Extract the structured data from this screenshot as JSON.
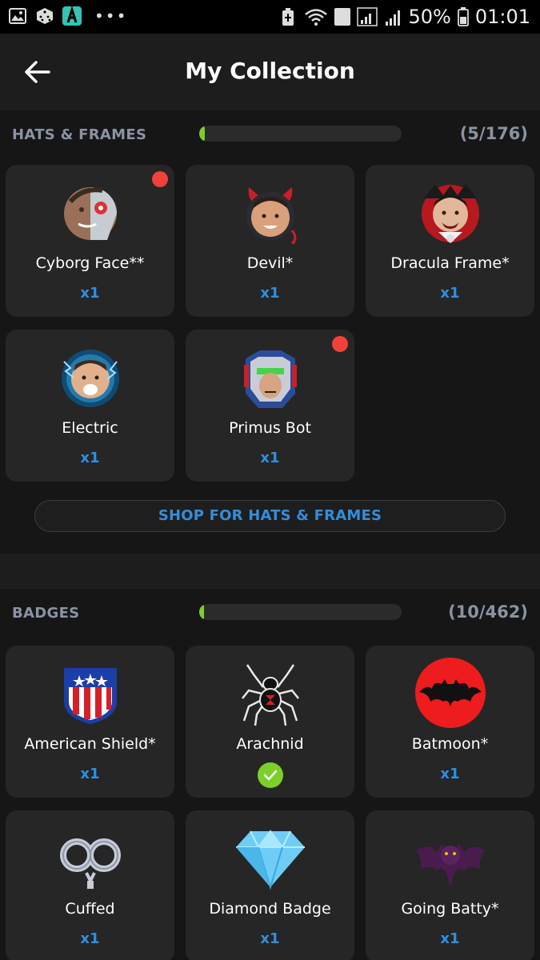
{
  "status_bar": {
    "battery": "50%",
    "time": "01:01",
    "sim_slot": "1"
  },
  "header": {
    "title": "My Collection",
    "back_icon": "arrow-left-icon"
  },
  "hats_frames": {
    "label": "HATS & FRAMES",
    "count": "(5/176)",
    "progress_fraction": 0.028,
    "items": [
      {
        "name": "Cyborg Face**",
        "qty": "x1",
        "new": true,
        "icon": "cyborg-face-icon"
      },
      {
        "name": "Devil*",
        "qty": "x1",
        "new": false,
        "icon": "devil-icon"
      },
      {
        "name": "Dracula Frame*",
        "qty": "x1",
        "new": false,
        "icon": "dracula-frame-icon"
      },
      {
        "name": "Electric",
        "qty": "x1",
        "new": false,
        "icon": "electric-icon"
      },
      {
        "name": "Primus Bot",
        "qty": "x1",
        "new": true,
        "icon": "primus-bot-icon"
      }
    ],
    "shop_label": "SHOP FOR HATS & FRAMES"
  },
  "badges": {
    "label": "BADGES",
    "count": "(10/462)",
    "progress_fraction": 0.022,
    "items": [
      {
        "name": "American Shield*",
        "qty": "x1",
        "icon": "shield-icon"
      },
      {
        "name": "Arachnid",
        "qty": "",
        "equipped": true,
        "icon": "spider-icon"
      },
      {
        "name": "Batmoon*",
        "qty": "x1",
        "icon": "bat-moon-icon"
      },
      {
        "name": "Cuffed",
        "qty": "x1",
        "icon": "handcuffs-icon"
      },
      {
        "name": "Diamond Badge",
        "qty": "x1",
        "icon": "diamond-icon"
      },
      {
        "name": "Going Batty*",
        "qty": "x1",
        "icon": "bat-icon"
      }
    ]
  },
  "colors": {
    "accent_blue": "#2f8fe0",
    "progress_green": "#7ccf2a",
    "new_dot_red": "#f2403a",
    "card_bg": "#262626"
  }
}
